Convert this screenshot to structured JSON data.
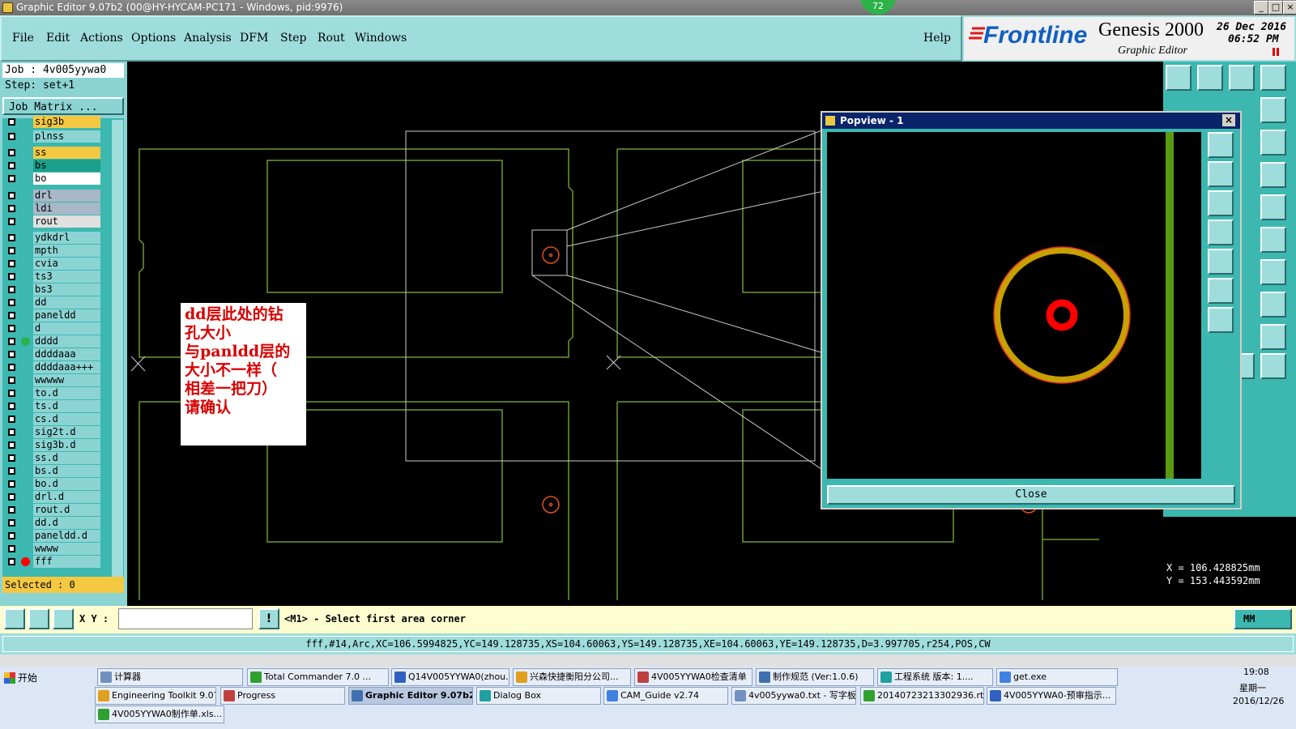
{
  "window": {
    "title": "Graphic Editor 9.07b2 (00@HY-HYCAM-PC171 - Windows, pid:9976)",
    "badge": "72"
  },
  "menu": {
    "items": [
      "File",
      "Edit",
      "Actions",
      "Options",
      "Analysis",
      "DFM",
      "Step",
      "Rout",
      "Windows"
    ],
    "help": "Help"
  },
  "brand": {
    "logo": "Frontline",
    "product": "Genesis 2000",
    "subtitle": "Graphic Editor",
    "date": "26 Dec 2016",
    "time": "06:52 PM"
  },
  "left": {
    "job": "Job : 4v005yywa0",
    "step": "Step: set+1",
    "job_matrix": "Job Matrix ...",
    "selected": "Selected : 0",
    "layers": [
      {
        "name": "sig3b",
        "color": "#f5c842"
      },
      {
        "name": "plnss",
        "color": "#8cd4d4"
      },
      {
        "name": "ss",
        "color": "#f5c842"
      },
      {
        "name": "bs",
        "color": "#1aa08a"
      },
      {
        "name": "bo",
        "color": "#ffffff"
      },
      {
        "name": "drl",
        "color": "#a8b8c8"
      },
      {
        "name": "ldi",
        "color": "#a8b8c8"
      },
      {
        "name": "rout",
        "color": "#e0e0e0"
      },
      {
        "name": "ydkdrl",
        "color": "#8cd4d4"
      },
      {
        "name": "mpth",
        "color": "#8cd4d4"
      },
      {
        "name": "cvia",
        "color": "#8cd4d4"
      },
      {
        "name": "ts3",
        "color": "#8cd4d4"
      },
      {
        "name": "bs3",
        "color": "#8cd4d4"
      },
      {
        "name": "dd",
        "color": "#8cd4d4"
      },
      {
        "name": "paneldd",
        "color": "#8cd4d4"
      },
      {
        "name": "d",
        "color": "#8cd4d4"
      },
      {
        "name": "dddd",
        "color": "#8cd4d4"
      },
      {
        "name": "ddddaaa",
        "color": "#8cd4d4"
      },
      {
        "name": "ddddaaa+++",
        "color": "#8cd4d4"
      },
      {
        "name": "wwwww",
        "color": "#8cd4d4"
      },
      {
        "name": "to.d",
        "color": "#8cd4d4"
      },
      {
        "name": "ts.d",
        "color": "#8cd4d4"
      },
      {
        "name": "cs.d",
        "color": "#8cd4d4"
      },
      {
        "name": "sig2t.d",
        "color": "#8cd4d4"
      },
      {
        "name": "sig3b.d",
        "color": "#8cd4d4"
      },
      {
        "name": "ss.d",
        "color": "#8cd4d4"
      },
      {
        "name": "bs.d",
        "color": "#8cd4d4"
      },
      {
        "name": "bo.d",
        "color": "#8cd4d4"
      },
      {
        "name": "drl.d",
        "color": "#8cd4d4"
      },
      {
        "name": "rout.d",
        "color": "#8cd4d4"
      },
      {
        "name": "dd.d",
        "color": "#8cd4d4"
      },
      {
        "name": "paneldd.d",
        "color": "#8cd4d4"
      },
      {
        "name": "wwww",
        "color": "#8cd4d4"
      },
      {
        "name": "fff",
        "color": "#8cd4d4"
      }
    ]
  },
  "annotation": {
    "lines": [
      "dd层此处的钻",
      "孔大小",
      "与panldd层的",
      "大小不一样（",
      "相差一把刀）",
      "请确认"
    ]
  },
  "popview": {
    "title": "Popview - 1",
    "close": "Close"
  },
  "coords": {
    "x": "X  =  106.428825mm",
    "y": "Y  =  153.443592mm"
  },
  "command": {
    "xy_label": "X Y :",
    "xy_value": "",
    "prompt": "<M1> - Select first area corner",
    "unit": "MM"
  },
  "status_line": "fff,#14,Arc,XC=106.5994825,YC=149.128735,XS=104.60063,YS=149.128735,XE=104.60063,YE=149.128735,D=3.997705,r254,POS,CW",
  "taskbar": {
    "start": "开始",
    "row1": [
      "计算器",
      "Total Commander 7.0 ...",
      "Q14V005YYWA0(zhou...",
      "兴森快捷衡阳分公司...",
      "4V005YYWA0检查清单",
      "制作规范 (Ver:1.0.6)",
      "工程系统  版本: 1....",
      "get.exe"
    ],
    "row2": [
      "Engineering Toolkit 9.07...",
      "Progress",
      "Graphic Editor 9.07b2...",
      "Dialog Box",
      "CAM_Guide v2.74",
      "4v005yywa0.txt - 写字板",
      "20140723213302936.rt...",
      "4V005YYWA0-预审指示..."
    ],
    "row3": [
      "4V005YYWA0制作单.xls..."
    ],
    "clock_time": "19:08",
    "clock_day": "星期一",
    "clock_date": "2016/12/26"
  }
}
